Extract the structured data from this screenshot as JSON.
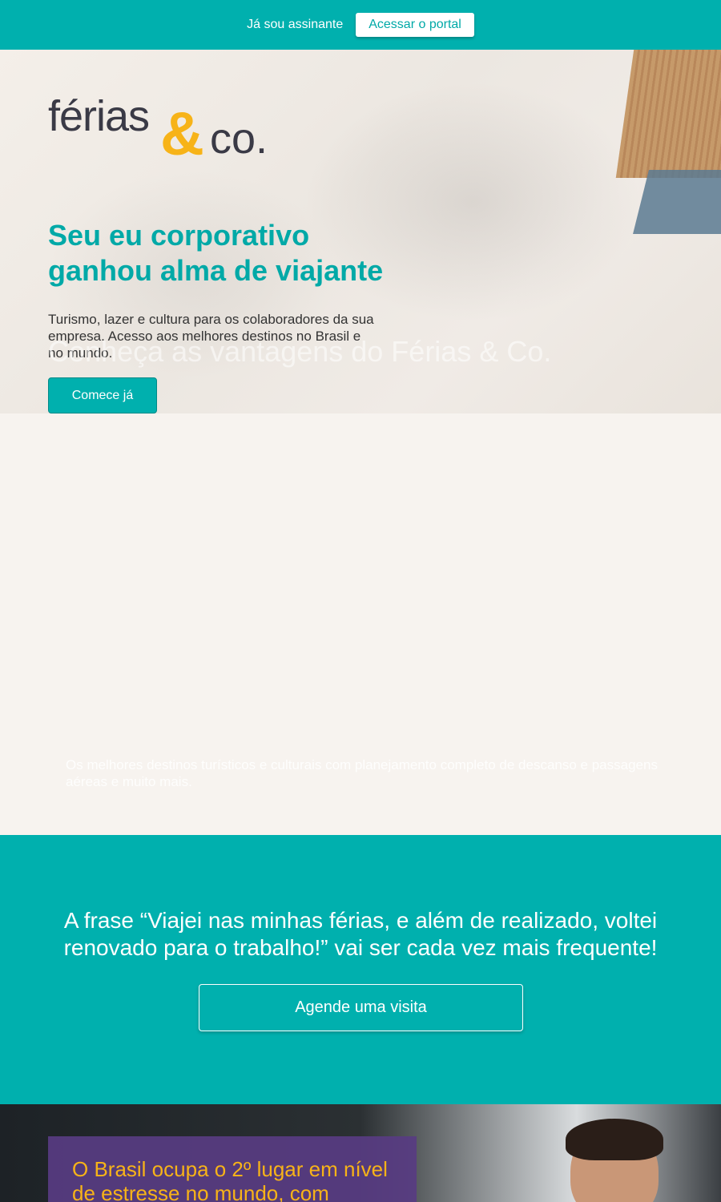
{
  "topbar": {
    "subscriber_label": "Já sou assinante",
    "portal_button": "Acessar o portal"
  },
  "hero": {
    "logo": {
      "word1": "férias",
      "ampersand": "&",
      "word2": "co."
    },
    "title": "Seu eu corporativo ganhou alma de viajante",
    "description": "Turismo, lazer e cultura para os colaboradores da sua empresa. Acesso aos melhores destinos no Brasil e no mundo.",
    "overlay_title": "Conheça as vantagens do Férias & Co.",
    "cta_button": "Comece já"
  },
  "features": {
    "faint_text": "Os melhores destinos turísticos e culturais com planejamento completo de descanso e passagens aéreas e muito mais."
  },
  "quote_section": {
    "quote": "A frase “Viajei nas minhas férias, e além de realizado, voltei renovado para o trabalho!” vai ser cada vez mais frequente!",
    "visit_button": "Agende uma visita"
  },
  "stats_section": {
    "stat_text": "O Brasil ocupa o 2º lugar em nível de estresse no mundo, com"
  },
  "colors": {
    "teal": "#00b0ae",
    "yellow": "#f7b318",
    "dark_text": "#3a3a46",
    "purple": "#583c82"
  }
}
